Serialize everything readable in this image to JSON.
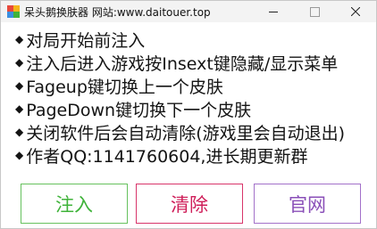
{
  "window": {
    "title": "呆头鹅换肤器 网站:www.daitouer.top",
    "controls": {
      "minimize": "—",
      "maximize": "☐",
      "close": "✕"
    }
  },
  "instructions": [
    "对局开始前注入",
    "注入后进入游戏按Insext键隐藏/显示菜单",
    "Fageup键切换上一个皮肤",
    "PageDown键切换下一个皮肤",
    "关闭软件后会自动清除(游戏里会自动退出)",
    "作者QQ:1141760604,进长期更新群"
  ],
  "bullet": "◆",
  "buttons": {
    "inject": "注入",
    "clear": "清除",
    "website": "官网"
  },
  "colors": {
    "inject": "#3fb33a",
    "clear": "#cf1e59",
    "website": "#8a4fb8",
    "icon": [
      "#e8493b",
      "#f5b51b",
      "#3a8fe0",
      "#3fb33a"
    ]
  }
}
